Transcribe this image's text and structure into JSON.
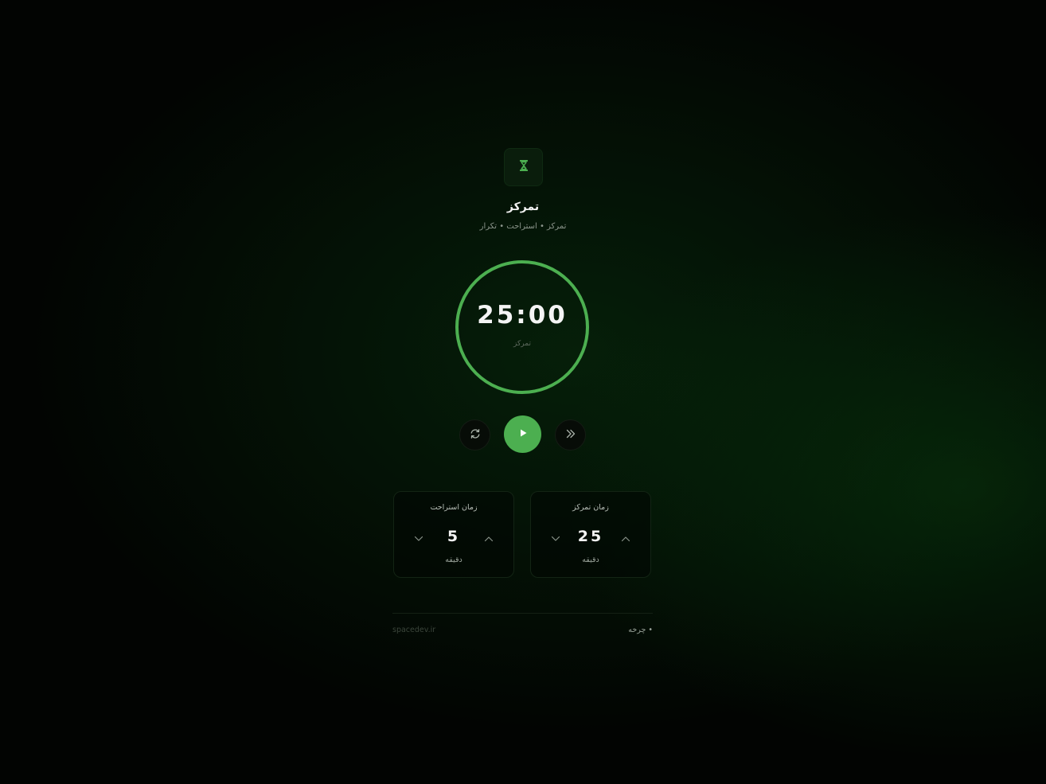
{
  "header": {
    "icon": "hourglass-icon",
    "title": "تمرکز",
    "subtitle": "تمرکز • استراحت • تکرار"
  },
  "timer": {
    "time": "25:00",
    "mode_label": "تمرکز",
    "progress": 1.0
  },
  "controls": {
    "reset_icon": "refresh-icon",
    "play_icon": "play-icon",
    "skip_icon": "double-chevron-icon"
  },
  "settings": {
    "break": {
      "title": "زمان استراحت",
      "value": "5",
      "unit": "دقیقه"
    },
    "focus": {
      "title": "زمان تمرکز",
      "value": "25",
      "unit": "دقیقه"
    }
  },
  "footer": {
    "site": "spacedev.ir",
    "cycle": "• چرخه"
  },
  "colors": {
    "accent": "#4caf50",
    "background": "#020402"
  }
}
